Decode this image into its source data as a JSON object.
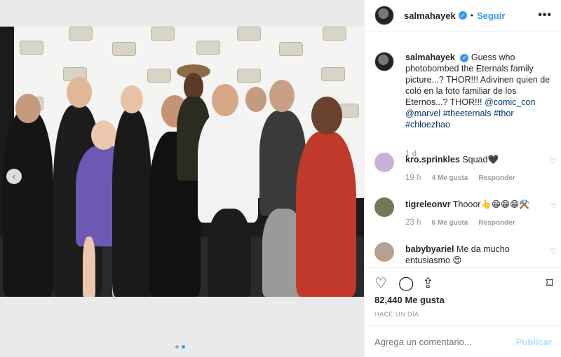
{
  "header": {
    "username": "salmahayek",
    "separator": "•",
    "follow_label": "Seguir",
    "more_label": "•••"
  },
  "caption": {
    "username": "salmahayek",
    "text_1": "Guess who photobombed the Eternals family picture...? THOR!!! Adivinen quien de coló en la foto familiar de los Eternos...? THOR!!! ",
    "mention_1": "@comic_con",
    "mention_2": "@marvel",
    "tag_1": "#theeternals",
    "tag_2": "#thor",
    "tag_3": "#chloezhao",
    "age": "1 d"
  },
  "comments": [
    {
      "username": "kro.sprinkles",
      "text": "Squad🖤",
      "age": "19 h",
      "likes": "4 Me gusta",
      "reply": "Responder"
    },
    {
      "username": "tigreleonvr",
      "text": "Thooor👆😁😁😁⚒️",
      "age": "23 h",
      "likes": "6 Me gusta",
      "reply": "Responder"
    },
    {
      "username": "babybyariel",
      "text": "Me da mucho entusiasmo 😍"
    }
  ],
  "actions": {
    "like_count": "82,440 Me gusta",
    "posted_time": "HACE UN DÍA"
  },
  "add_comment": {
    "placeholder": "Agrega un comentario...",
    "post_label": "Publicar"
  },
  "colors": {
    "accent": "#3897f0",
    "muted": "#999999"
  }
}
